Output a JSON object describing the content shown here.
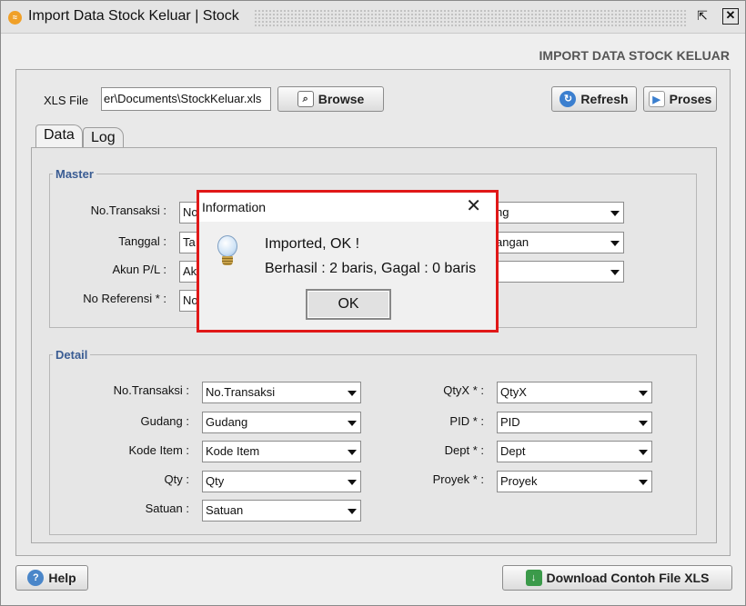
{
  "window": {
    "title": "Import Data Stock Keluar | Stock",
    "restore_icon": "restore-icon",
    "close_icon": "close-icon"
  },
  "header": {
    "title": "IMPORT DATA STOCK KELUAR"
  },
  "file": {
    "label": "XLS File",
    "path": "er\\Documents\\StockKeluar.xls",
    "browse_label": "Browse"
  },
  "actions": {
    "refresh_label": "Refresh",
    "proses_label": "Proses"
  },
  "tabs": [
    {
      "label": "Data"
    },
    {
      "label": "Log"
    }
  ],
  "master": {
    "title": "Master",
    "fields": [
      {
        "label": "No.Transaksi :",
        "value": "No",
        "right_value": "ng"
      },
      {
        "label": "Tanggal :",
        "value": "Ta",
        "right_value": "angan"
      },
      {
        "label": "Akun P/L :",
        "value": "Ak",
        "right_value": ""
      },
      {
        "label": "No Referensi * :",
        "value": "No"
      }
    ]
  },
  "detail": {
    "title": "Detail",
    "left": [
      {
        "label": "No.Transaksi :",
        "value": "No.Transaksi"
      },
      {
        "label": "Gudang :",
        "value": "Gudang"
      },
      {
        "label": "Kode Item :",
        "value": "Kode Item"
      },
      {
        "label": "Qty :",
        "value": "Qty"
      },
      {
        "label": "Satuan :",
        "value": "Satuan"
      }
    ],
    "right": [
      {
        "label": "QtyX * :",
        "value": "QtyX"
      },
      {
        "label": "PID * :",
        "value": "PID"
      },
      {
        "label": "Dept * :",
        "value": "Dept"
      },
      {
        "label": "Proyek * :",
        "value": "Proyek"
      }
    ]
  },
  "footer": {
    "help_label": "Help",
    "download_label": "Download Contoh File XLS"
  },
  "dialog": {
    "title": "Information",
    "message_line1": "Imported, OK !",
    "message_line2": "Berhasil : 2 baris, Gagal : 0 baris",
    "ok_label": "OK",
    "icon": "lightbulb-icon",
    "highlight_color": "#e01818"
  }
}
